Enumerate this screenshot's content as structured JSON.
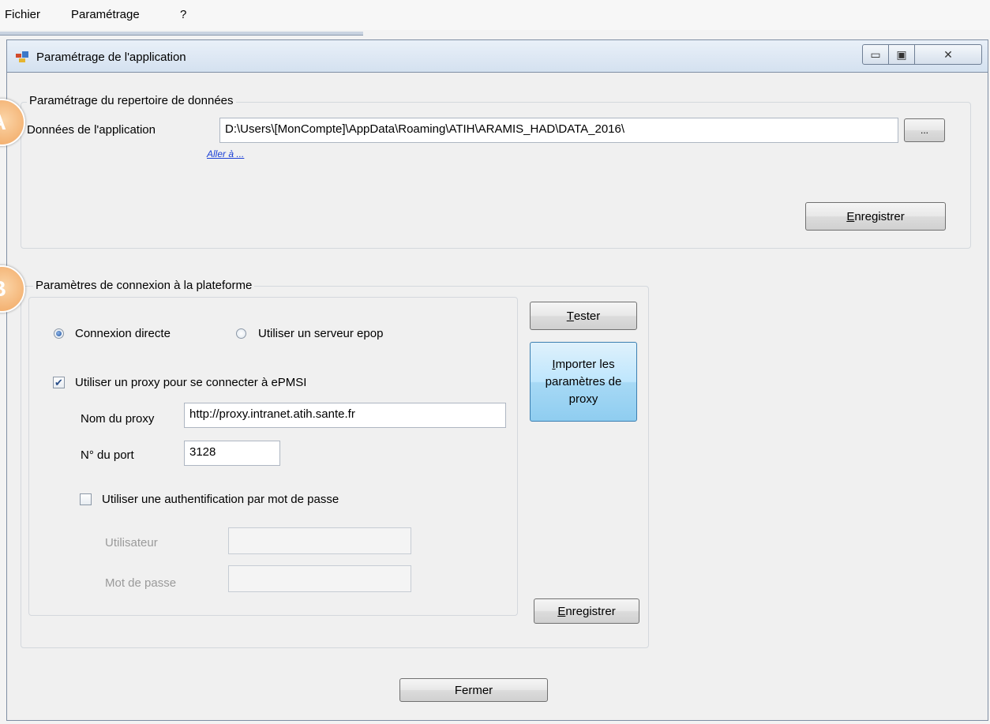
{
  "menu": {
    "items": [
      "Fichier",
      "Paramétrage",
      "?"
    ]
  },
  "window": {
    "title": "Paramétrage de l'application",
    "buttons": {
      "minimize": "▭",
      "restore": "▣",
      "close": "✕"
    }
  },
  "section_a": {
    "badge": "A",
    "legend": "Paramétrage du repertoire de données",
    "data_label": "Données de l'application",
    "data_path": "D:\\Users\\[MonCompte]\\AppData\\Roaming\\ATIH\\ARAMIS_HAD\\DATA_2016\\",
    "browse_label": "...",
    "goto_link": "Aller à ...",
    "save_prefix": "E",
    "save_rest": "nregistrer"
  },
  "section_b": {
    "badge": "B",
    "legend": "Paramètres de connexion à la plateforme",
    "radio_direct": "Connexion directe",
    "radio_epop": "Utiliser un serveur epop",
    "proxy_check": "Utiliser un proxy pour se connecter à ePMSI",
    "proxy_name_label": "Nom du proxy",
    "proxy_name_value": "http://proxy.intranet.atih.sante.fr",
    "port_label": "N° du port",
    "port_value": "3128",
    "auth_check": "Utiliser une authentification par mot de passe",
    "user_label": "Utilisateur",
    "user_value": "",
    "password_label": "Mot de passe",
    "password_value": "",
    "test_prefix": "T",
    "test_rest": "ester",
    "import_line1_prefix": "I",
    "import_line1_rest": "mporter les",
    "import_line2": "paramètres de",
    "import_line3": "proxy",
    "save_prefix": "E",
    "save_rest": "nregistrer"
  },
  "footer": {
    "close_label": "Fermer"
  },
  "state": {
    "radio_direct_selected": true,
    "proxy_checked": true,
    "auth_checked": false
  }
}
